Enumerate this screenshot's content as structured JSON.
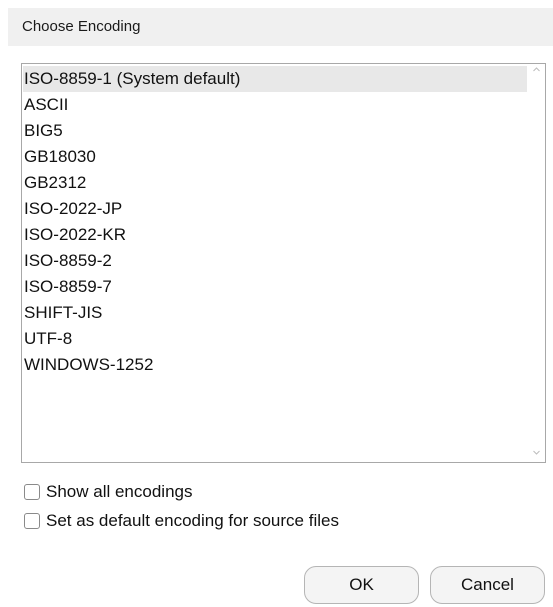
{
  "dialog": {
    "title": "Choose Encoding"
  },
  "encodings": {
    "items": [
      {
        "label": "ISO-8859-1 (System default)",
        "selected": true
      },
      {
        "label": "ASCII",
        "selected": false
      },
      {
        "label": "BIG5",
        "selected": false
      },
      {
        "label": "GB18030",
        "selected": false
      },
      {
        "label": "GB2312",
        "selected": false
      },
      {
        "label": "ISO-2022-JP",
        "selected": false
      },
      {
        "label": "ISO-2022-KR",
        "selected": false
      },
      {
        "label": "ISO-8859-2",
        "selected": false
      },
      {
        "label": "ISO-8859-7",
        "selected": false
      },
      {
        "label": "SHIFT-JIS",
        "selected": false
      },
      {
        "label": "UTF-8",
        "selected": false
      },
      {
        "label": "WINDOWS-1252",
        "selected": false
      }
    ]
  },
  "options": {
    "show_all": {
      "label": "Show all encodings",
      "checked": false
    },
    "set_default": {
      "label": "Set as default encoding for source files",
      "checked": false
    }
  },
  "buttons": {
    "ok_label": "OK",
    "cancel_label": "Cancel"
  },
  "icons": {
    "scroll_up": "chevron-up-icon",
    "scroll_down": "chevron-down-icon"
  }
}
